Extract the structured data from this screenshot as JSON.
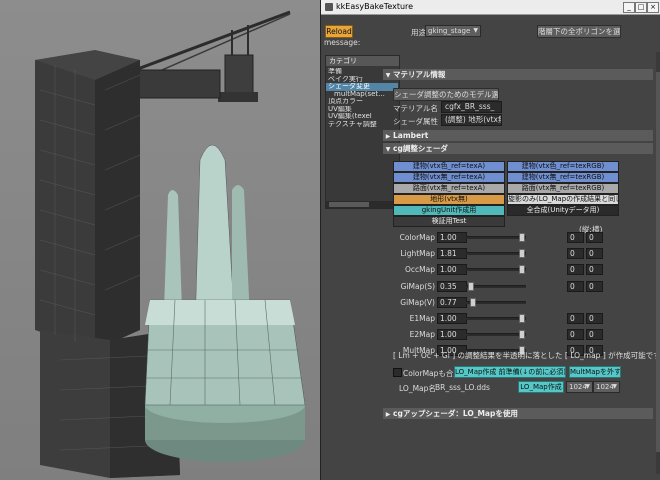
{
  "window": {
    "title": "kkEasyBakeTexture",
    "min_label": "_",
    "max_label": "□",
    "close_label": "×"
  },
  "toolbar": {
    "reload_label": "Reload",
    "usage_label": "用途",
    "usage_value": "gking_stage",
    "select_polygons_label": "階層下の全ポリゴンを選択",
    "message_label": "message:"
  },
  "sidebar": {
    "header": "カテゴリ",
    "items": [
      {
        "label": "準備",
        "selected": false,
        "indent": false
      },
      {
        "label": "ベイク実行",
        "selected": false,
        "indent": false
      },
      {
        "label": "シェーダ変更",
        "selected": true,
        "indent": false
      },
      {
        "label": "multMap(set...",
        "selected": false,
        "indent": true
      },
      {
        "label": "頂点カラー",
        "selected": false,
        "indent": false
      },
      {
        "label": "UV編集",
        "selected": false,
        "indent": false
      },
      {
        "label": "UV編集(texel",
        "selected": false,
        "indent": false
      },
      {
        "label": "テクスチャ調整",
        "selected": false,
        "indent": false
      }
    ]
  },
  "material_section": {
    "header": "マテリアル情報",
    "select_model_button": "シェーダ調整のためのモデル選択",
    "material_name_label": "マテリアル名",
    "material_name_value": "cgfx_BR_sss_",
    "shader_attr_label": "シェーダ属性",
    "shader_attr_value": "(調整) 地形(vtx無)"
  },
  "lambert_section": {
    "header": "Lambert"
  },
  "cg_section": {
    "header": "cg調整シェーダ",
    "preset_buttons": [
      {
        "label": "建物(vtx色_ref=texA)",
        "color": "#6f8fd0"
      },
      {
        "label": "建物(vtx色_ref=texRGB)",
        "color": "#6f8fd0"
      },
      {
        "label": "建物(vtx無_ref=texA)",
        "color": "#6f8fd0"
      },
      {
        "label": "建物(vtx無_ref=texRGB)",
        "color": "#6f8fd0"
      },
      {
        "label": "路面(vtx無_ref=texA)",
        "color": "#a9a9a9"
      },
      {
        "label": "路面(vtx無_ref=texRGB)",
        "color": "#a9a9a9"
      },
      {
        "label": "地形(vtx無)",
        "color": "#d89a46"
      },
      {
        "label": "旋影のみ(LO_Mapの作成結果と同じ)",
        "color": "#d9d9d9"
      },
      {
        "label": "gkingUnit作成用",
        "color": "#50b8b8"
      },
      {
        "label": "全合成(Unityデータ用)",
        "color": "#2a2a2a"
      },
      {
        "label": "検証用Test",
        "color": "#3a3a3a"
      }
    ],
    "xy_header": "(縦:横)",
    "sliders": [
      {
        "label": "ColorMap",
        "value": "1.00",
        "level": 0.95,
        "a": "0",
        "b": "0"
      },
      {
        "label": "LightMap",
        "value": "1.81",
        "level": 0.95,
        "a": "0",
        "b": "0"
      },
      {
        "label": "OccMap",
        "value": "1.00",
        "level": 0.95,
        "a": "0",
        "b": "0"
      },
      {
        "label": "GiMap(S)",
        "value": "0.35",
        "level": 0.04,
        "a": "0",
        "b": "0"
      },
      {
        "label": "GiMap(V)",
        "value": "0.77",
        "level": 0.08,
        "a": null,
        "b": null
      },
      {
        "label": "E1Map",
        "value": "1.00",
        "level": 0.95,
        "a": "0",
        "b": "0"
      },
      {
        "label": "E2Map",
        "value": "1.00",
        "level": 0.95,
        "a": "0",
        "b": "0"
      },
      {
        "label": "MultMap",
        "value": "1.00",
        "level": 0.95,
        "a": "0",
        "b": "0"
      }
    ],
    "note": "[ Lm + Oc + Gi ] の調整結果を半透明に落とした [ LO_map ] が作成可能です",
    "colormap_combine_label": "ColorMapも合成",
    "lomap_create_button": "LO_Map作成 前準備(↓の前に必須)",
    "multmap_remove_button": "MultMapを外す",
    "lomap_name_label": "LO_Map名",
    "lomap_name_value": "BR_sss_LO.dds",
    "lomap_make_button": "LO_Map作成",
    "size_w": "1024",
    "size_h": "1024"
  },
  "cg_up_section": {
    "header": "cgアップシェーダ：LO_Mapを使用"
  }
}
